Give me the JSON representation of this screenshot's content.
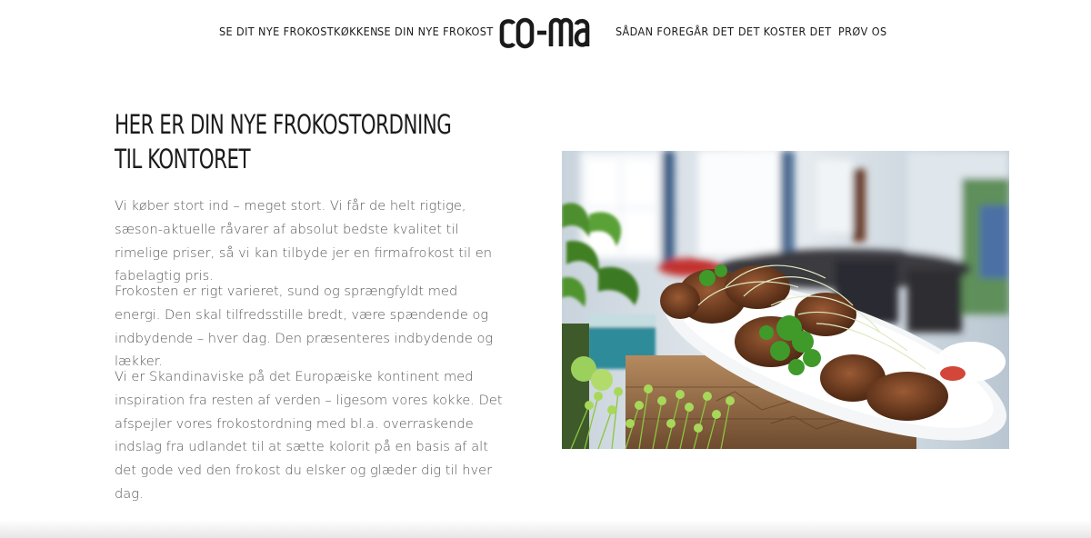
{
  "nav": {
    "left_items": [
      {
        "label": "SE DIT NYE FROKOSTKØKKEN"
      },
      {
        "label": "SE DIN NYE FROKOST"
      }
    ],
    "logo_text": "co-ma",
    "right_items": [
      {
        "label": "SÅDAN FOREGÅR DET"
      },
      {
        "label": "DET KOSTER DET"
      },
      {
        "label": "PRØV OS"
      }
    ]
  },
  "main": {
    "headline_line1": "HER ER DIN NYE FROKOSTORDNING",
    "headline_line2": "TIL KONTORET",
    "paragraphs": [
      "Vi køber stort ind – meget stort. Vi får de helt rigtige, sæson-aktuelle råvarer af absolut bedste kvalitet til rimelige priser, så vi kan tilbyde jer en firmafrokost til en fabelagtig pris.",
      "Frokosten er rigt varieret, sund og sprængfyldt med energi. Den skal tilfredsstille bredt, være spændende og indbydende – hver dag. Den præsenteres indbydende og lækker.",
      "Vi er Skandinaviske på det Europæiske kontinent med inspiration fra resten af verden – ligesom vores kokke. Det afspejler vores frokostordning med bl.a. overraskende indslag fra udlandet til at sætte kolorit på en basis af alt det gode ved den frokost du elsker og glæder dig til hver dag."
    ]
  },
  "colors": {
    "text_dark": "#1a1a1a",
    "text_body": "#5a5a5a",
    "background": "#ffffff"
  }
}
